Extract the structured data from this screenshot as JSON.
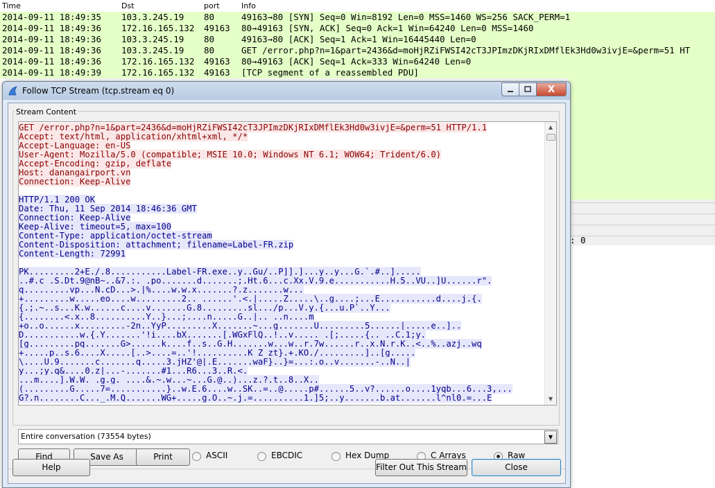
{
  "packet_list": {
    "columns": [
      "Time",
      "Dst",
      "port",
      "Info"
    ],
    "rows": [
      {
        "time": "2014-09-11 18:49:35",
        "dst": "103.3.245.19",
        "port": "80",
        "info": "49163→80 [SYN] Seq=0 Win=8192 Len=0 MSS=1460 WS=256 SACK_PERM=1"
      },
      {
        "time": "2014-09-11 18:49:36",
        "dst": "172.16.165.132",
        "port": "49163",
        "info": "80→49163 [SYN, ACK] Seq=0 Ack=1 Win=64240 Len=0 MSS=1460"
      },
      {
        "time": "2014-09-11 18:49:36",
        "dst": "103.3.245.19",
        "port": "80",
        "info": "49163→80 [ACK] Seq=1 Ack=1 Win=16445440 Len=0"
      },
      {
        "time": "2014-09-11 18:49:36",
        "dst": "103.3.245.19",
        "port": "80",
        "info": "GET /error.php?n=1&part=2436&d=moHjRZiFWSI42cT3JPImzDKjRIxDMflEk3Hd0w3ivjE=&perm=51 HT"
      },
      {
        "time": "2014-09-11 18:49:36",
        "dst": "172.16.165.132",
        "port": "49163",
        "info": "80→49163 [ACK] Seq=1 Ack=333 Win=64240 Len=0"
      },
      {
        "time": "2014-09-11 18:49:39",
        "dst": "172.16.165.132",
        "port": "49163",
        "info": "[TCP segment of a reassembled PDU]"
      }
    ],
    "detail_fragment": ": 0"
  },
  "dialog": {
    "title": "Follow TCP Stream (tcp.stream eq 0)",
    "close_glyph": "X",
    "group_label": "Stream Content",
    "client_lines": [
      "GET /error.php?n=1&part=2436&d=moHjRZiFWSI42cT3JPImzDKjRIxDMflEk3Hd0w3ivjE=&perm=51 HTTP/1.1",
      "Accept: text/html, application/xhtml+xml, */*",
      "Accept-Language: en-US",
      "User-Agent: Mozilla/5.0 (compatible; MSIE 10.0; Windows NT 6.1; WOW64; Trident/6.0)",
      "Accept-Encoding: gzip, deflate",
      "Host: danangairport.vn",
      "Connection: Keep-Alive"
    ],
    "server_lines": [
      "HTTP/1.1 200 OK",
      "Date: Thu, 11 Sep 2014 18:46:36 GMT",
      "Connection: Keep-Alive",
      "Keep-Alive: timeout=5, max=100",
      "Content-Type: application/octet-stream",
      "Content-Disposition: attachment; filename=Label-FR.zip",
      "Content-Length: 72991"
    ],
    "binary_lines": [
      "PK.........2+E./.8...........Label-FR.exe..y..Gu/..P]].]...y..y...G.`.#..].....",
      "..#.c .S.Dt.9@nB~..&7.:._.po.......d.......;.Ht.6...c.Xx.V.9.e...........H.5..VU..]U......r\".",
      "q.........vp...N.cD...>.|%....w.w.x.......?.z.......w...",
      "+.........w.....eo....w.........2.._......'.<.|.....Z.....\\..g....;...E...........d....j.{.",
      "{.;.~..s...K.w......c....v.......G.8.........sl.../p...V.y.{...u.P`..Y...",
      "{........<.x..8..........Y..}...;....n.....G..|.._..n....m",
      "+o..o......x.........-2n..YyP.........X.......~...g.......U.........5......|.....e..]..",
      "D...........w.{.Y.......'!i....bX.......[.WGxFlQ..!..v....._.[;.....{.._..C.1;y.",
      "[g.........pq.......G>......k....f..s..G.H.......w...w..r.7w......r..x.N.r.K..<..%..azj..wq",
      "+.....p..s.6....X.....[..>....=..'!..........K_Z_zt}.+.KO./.........]..[g.....",
      "\\....U.9.......c.......q.....3.jHZ'@|.E.......waF}..}=...:.o..v.......-..N..|",
      "y...;y.q&....0.z|...-.......#1...R6...3..R.<.",
      "...m....].W.W._.g.g. ....&.~.w...~...G.@..)...z.?.t..8..X..",
      "(.........G.....7=...........}..w.E.6....w..SK..=..@.....p#......5..v?......o....1yqb...6...3,...",
      "G?.n........C..._.M.Q.......WG+.....g.O..~.j.=..........1.]5;..y.......b.at.......l^nl0.=...E"
    ],
    "conversation_select": "Entire conversation (73554 bytes)",
    "buttons": {
      "find": "Find",
      "save_as": "Save As",
      "print": "Print",
      "help": "Help",
      "filter_out": "Filter Out This Stream",
      "close": "Close"
    },
    "radio_options": [
      "ASCII",
      "EBCDIC",
      "Hex Dump",
      "C Arrays",
      "Raw"
    ],
    "radio_selected": "Raw"
  }
}
